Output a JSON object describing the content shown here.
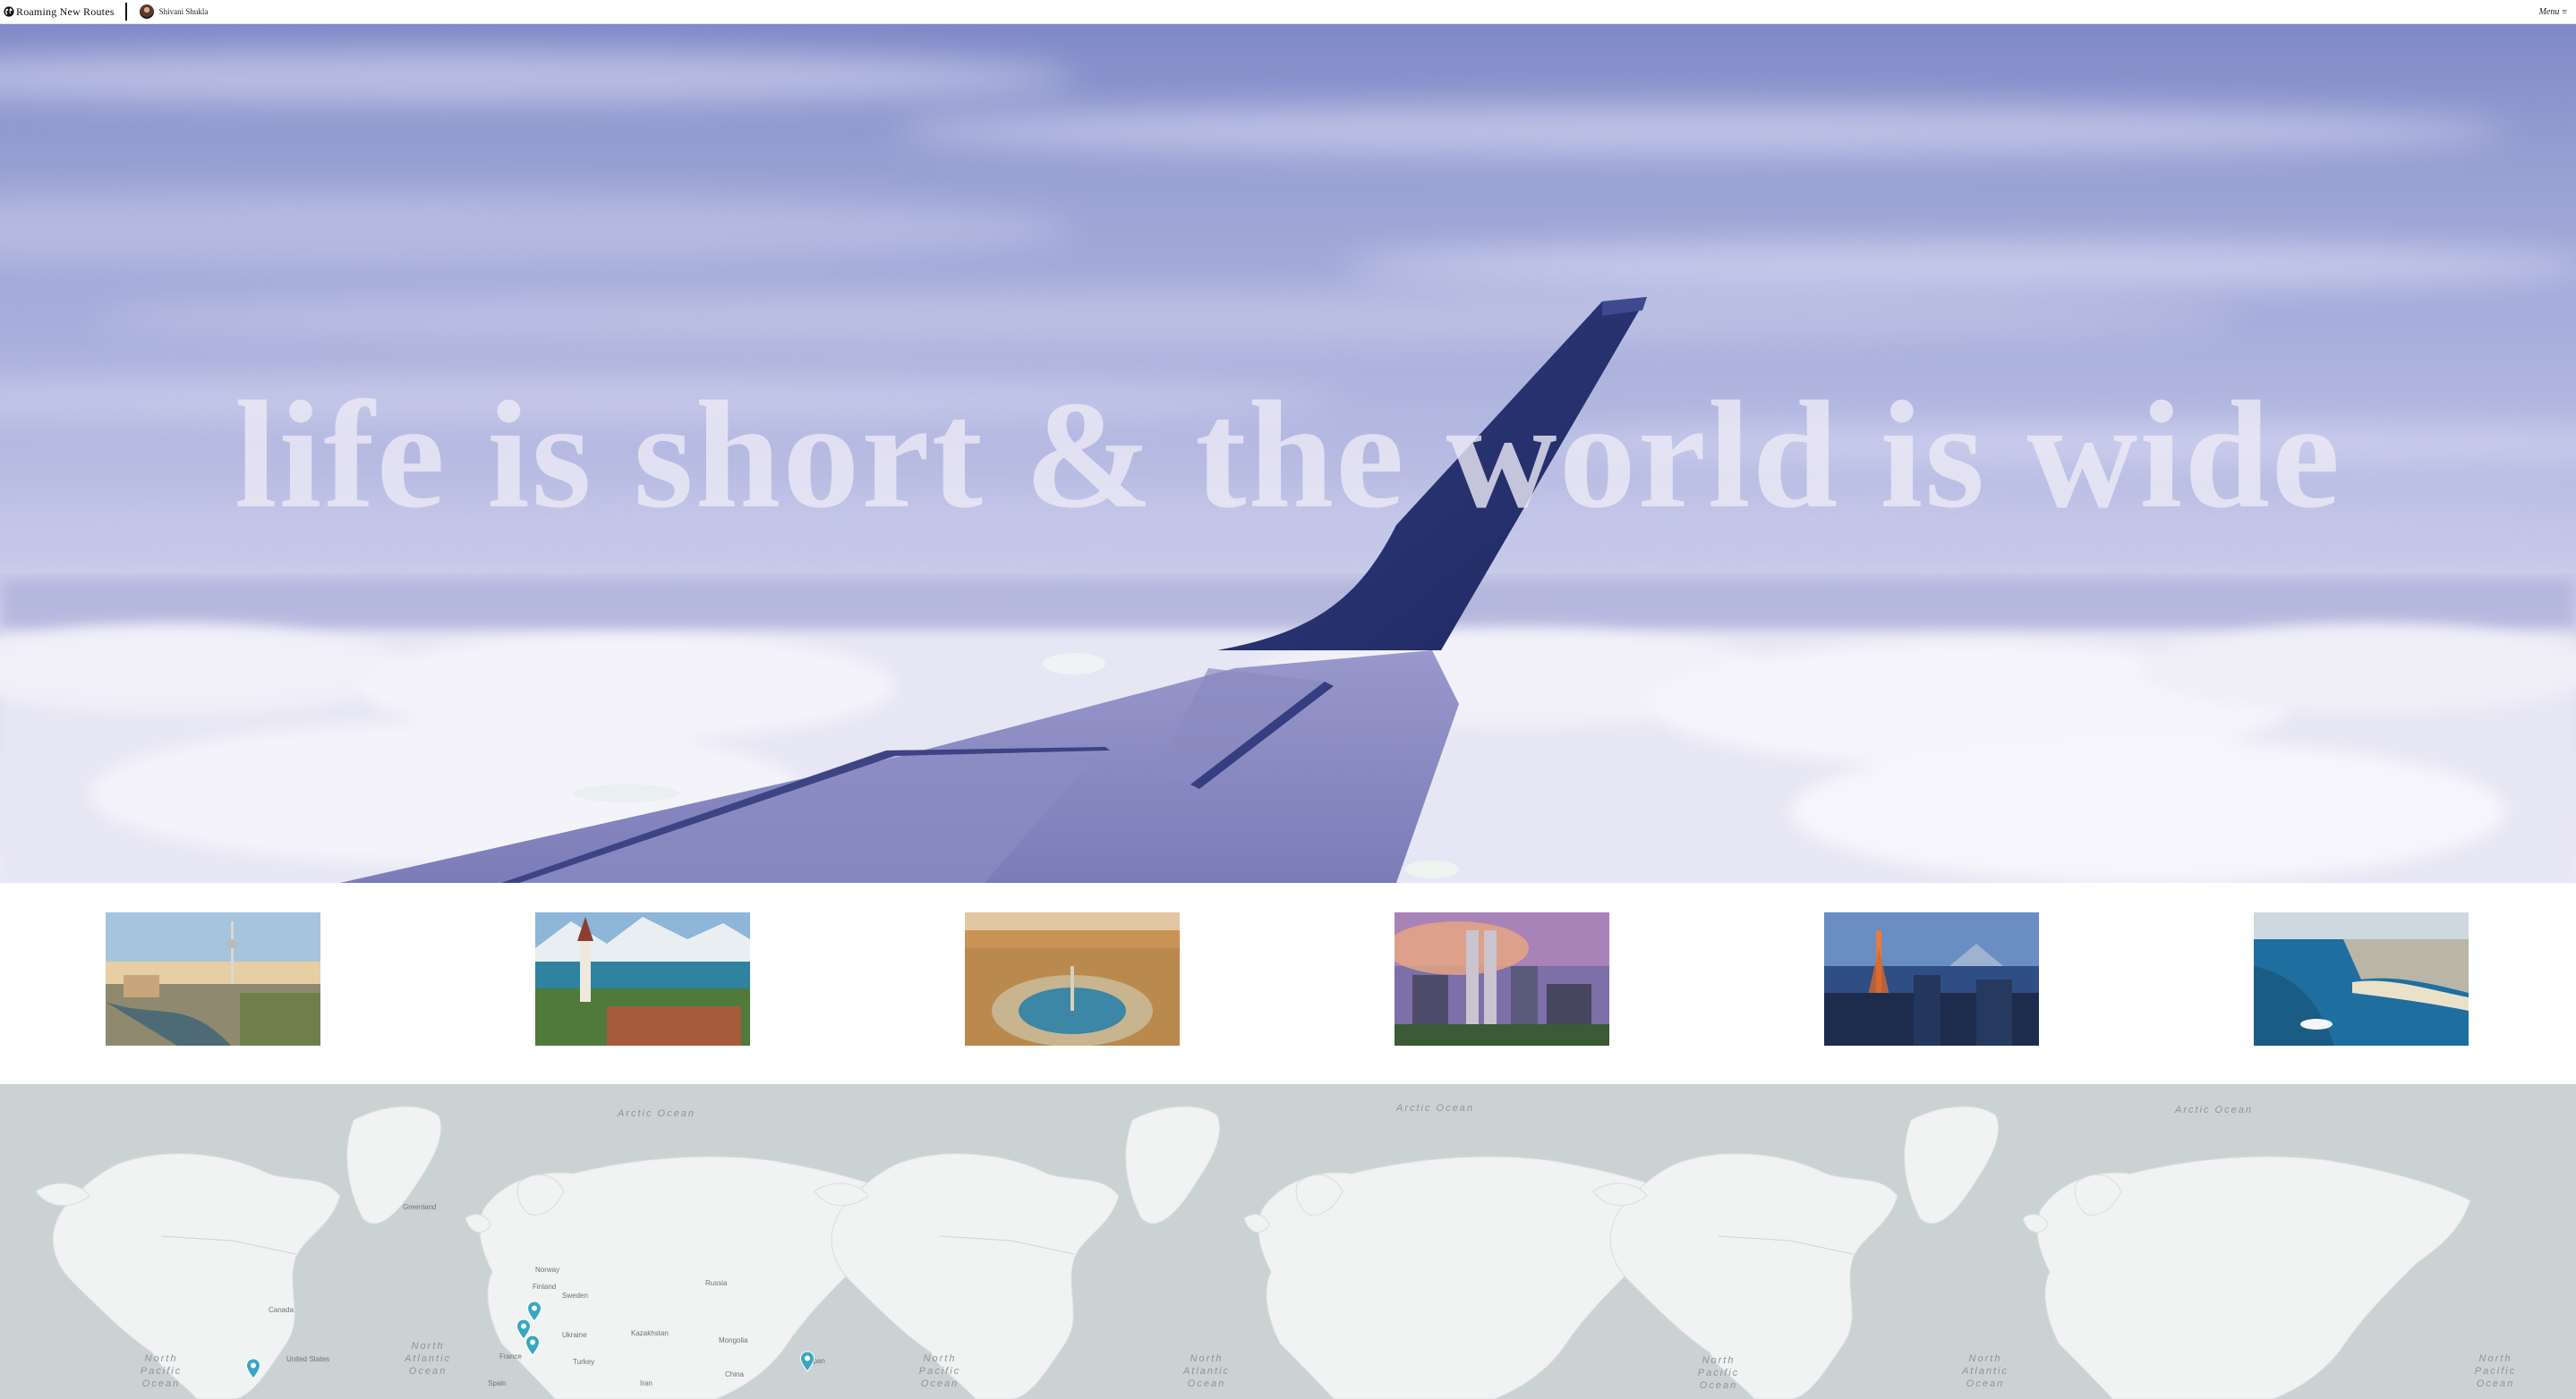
{
  "header": {
    "brand": "Roaming New Routes",
    "author": "Shivani Shukla",
    "menu_label": "Menu",
    "menu_icon": "hamburger-icon"
  },
  "hero": {
    "tagline": "life is short & the world is wide"
  },
  "destinations": [
    {
      "name": "city-river-tower"
    },
    {
      "name": "alpine-lake-church"
    },
    {
      "name": "square-aerial"
    },
    {
      "name": "twin-towers-skyline"
    },
    {
      "name": "tower-night-skyline"
    },
    {
      "name": "coastal-beach"
    }
  ],
  "map": {
    "ocean_labels": [
      "Arctic Ocean",
      "Arctic Ocean",
      "Arctic Ocean",
      "North Pacific Ocean",
      "North Atlantic Ocean",
      "North Pacific Ocean",
      "North Atlantic Ocean",
      "North Pacific Ocean",
      "North Atlantic Ocean",
      "North Pacific Ocean"
    ],
    "land_labels": [
      "Greenland",
      "Russia",
      "Canada",
      "United States",
      "Mongolia",
      "Kazakhstan",
      "Norway",
      "Sweden",
      "Finland",
      "Ukraine",
      "France",
      "Spain",
      "Turkey",
      "Iran",
      "China",
      "Japan"
    ],
    "pin_color": "#3aa6c0"
  }
}
